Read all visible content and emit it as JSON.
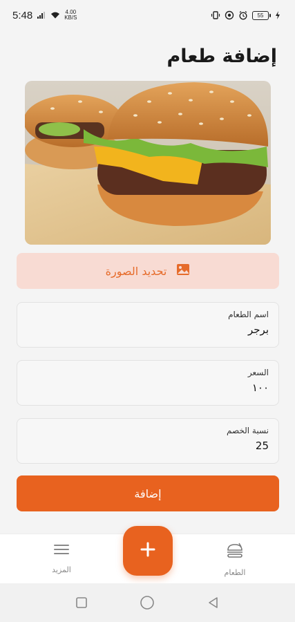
{
  "status_bar": {
    "time": "5:48",
    "net_speed_top": "4.00",
    "net_speed_bottom": "KB/S",
    "battery": "55",
    "icons": [
      "signal-icon",
      "wifi-icon",
      "vibrate-icon",
      "dnd-icon",
      "alarm-icon",
      "battery-icon",
      "charging-icon"
    ]
  },
  "page": {
    "title": "إضافة طعام"
  },
  "image_picker": {
    "label": "تحديد الصورة",
    "icon": "image-icon"
  },
  "form": {
    "name": {
      "label": "اسم الطعام",
      "value": "برجر"
    },
    "price": {
      "label": "السعر",
      "value": "١٠٠"
    },
    "discount": {
      "label": "نسبة الخصم",
      "value": "25"
    }
  },
  "submit": {
    "label": "إضافة"
  },
  "bottom_nav": {
    "food_label": "الطعام",
    "more_label": "المزيد",
    "fab_icon": "plus-icon"
  },
  "colors": {
    "accent": "#e8621f",
    "accent_light": "#f8dbd3"
  }
}
